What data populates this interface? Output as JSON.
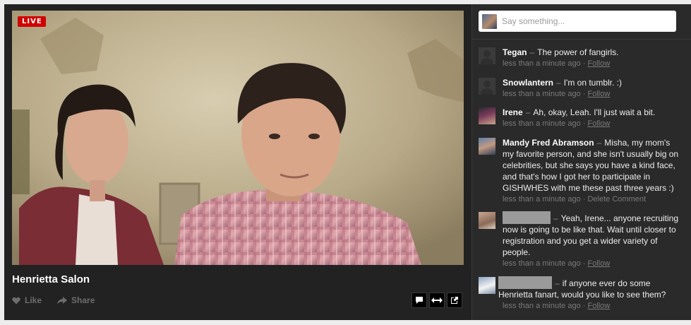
{
  "video": {
    "live_label": "LIVE",
    "title": "Henrietta Salon"
  },
  "actions": {
    "like_label": "Like",
    "share_label": "Share"
  },
  "chat": {
    "placeholder": "Say something...",
    "meta_separator": "·",
    "messages": [
      {
        "name": "Tegan",
        "text": "The power of fangirls.",
        "time": "less than a minute ago",
        "action": "Follow",
        "avatar": "default-avatar"
      },
      {
        "name": "Snowlantern",
        "text": "I'm on tumblr. :)",
        "time": "less than a minute ago",
        "action": "Follow",
        "avatar": "default-avatar"
      },
      {
        "name": "Irene",
        "text": "Ah, okay, Leah. I'll just wait a bit.",
        "time": "less than a minute ago",
        "action": "Follow",
        "avatar": "user-photo"
      },
      {
        "name": "Mandy Fred Abramson",
        "text": "Misha, my mom's my favorite person, and she isn't usually big on celebrities, but she says you have a kind face, and that's how I got her to participate in GISHWHES with me these past three years :)",
        "time": "less than a minute ago",
        "action": "Delete Comment",
        "avatar": "user-photo"
      },
      {
        "name": "",
        "text": "Yeah, Irene... anyone recruiting now is going to be like that. Wait until closer to registration and you get a wider variety of people.",
        "time": "less than a minute ago",
        "action": "Follow",
        "avatar": "user-photo"
      },
      {
        "name": "",
        "text": "if anyone ever do some Henrietta fanart, would you like to see them?",
        "time": "less than a minute ago",
        "action": "Follow",
        "avatar": "user-photo"
      }
    ]
  },
  "colors": {
    "live_badge": "#d10000",
    "panel_bg": "#222222",
    "chat_bg": "#2a2a2a"
  }
}
